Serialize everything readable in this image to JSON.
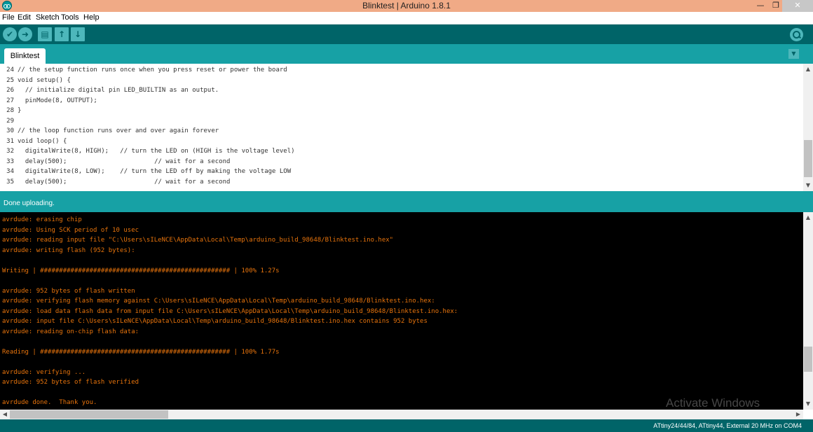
{
  "window": {
    "title": "Blinktest | Arduino 1.8.1",
    "min_glyph": "—",
    "max_glyph": "❐",
    "close_glyph": "✕"
  },
  "menu": [
    "File",
    "Edit",
    "Sketch",
    "Tools",
    "Help"
  ],
  "toolbar": {
    "verify_icon": "✔",
    "upload_icon": "➜",
    "new_icon": "▤",
    "open_icon": "↑",
    "save_icon": "↓",
    "serial_monitor_icon": "magnifier-icon"
  },
  "tabs": [
    {
      "label": "Blinktest"
    }
  ],
  "tab_menu_glyph": "▼",
  "editor": {
    "line_numbers": [
      "24",
      "25",
      "26",
      "27",
      "28",
      "29",
      "30",
      "31",
      "32",
      "33",
      "34",
      "35"
    ],
    "lines": [
      "// the setup function runs once when you press reset or power the board",
      "void setup() {",
      "  // initialize digital pin LED_BUILTIN as an output.",
      "  pinMode(8, OUTPUT);",
      "}",
      "",
      "// the loop function runs over and over again forever",
      "void loop() {",
      "  digitalWrite(8, HIGH);   // turn the LED on (HIGH is the voltage level)",
      "  delay(500);                       // wait for a second",
      "  digitalWrite(8, LOW);    // turn the LED off by making the voltage LOW",
      "  delay(500);                       // wait for a second"
    ]
  },
  "status": {
    "message": "Done uploading."
  },
  "console": {
    "lines": [
      "avrdude: erasing chip",
      "avrdude: Using SCK period of 10 usec",
      "avrdude: reading input file \"C:\\Users\\sILeNCE\\AppData\\Local\\Temp\\arduino_build_98648/Blinktest.ino.hex\"",
      "avrdude: writing flash (952 bytes):",
      "",
      "Writing | ################################################## | 100% 1.27s",
      "",
      "avrdude: 952 bytes of flash written",
      "avrdude: verifying flash memory against C:\\Users\\sILeNCE\\AppData\\Local\\Temp\\arduino_build_98648/Blinktest.ino.hex:",
      "avrdude: load data flash data from input file C:\\Users\\sILeNCE\\AppData\\Local\\Temp\\arduino_build_98648/Blinktest.ino.hex:",
      "avrdude: input file C:\\Users\\sILeNCE\\AppData\\Local\\Temp\\arduino_build_98648/Blinktest.ino.hex contains 952 bytes",
      "avrdude: reading on-chip flash data:",
      "",
      "Reading | ################################################## | 100% 1.77s",
      "",
      "avrdude: verifying ...",
      "avrdude: 952 bytes of flash verified",
      "",
      "avrdude done.  Thank you."
    ]
  },
  "footer": {
    "board": "ATtiny24/44/84, ATtiny44, External 20 MHz on COM4"
  },
  "watermark": "Activate Windows",
  "colors": {
    "teal_dark": "#006468",
    "teal": "#17a1a5",
    "console_text": "#e8740c"
  }
}
